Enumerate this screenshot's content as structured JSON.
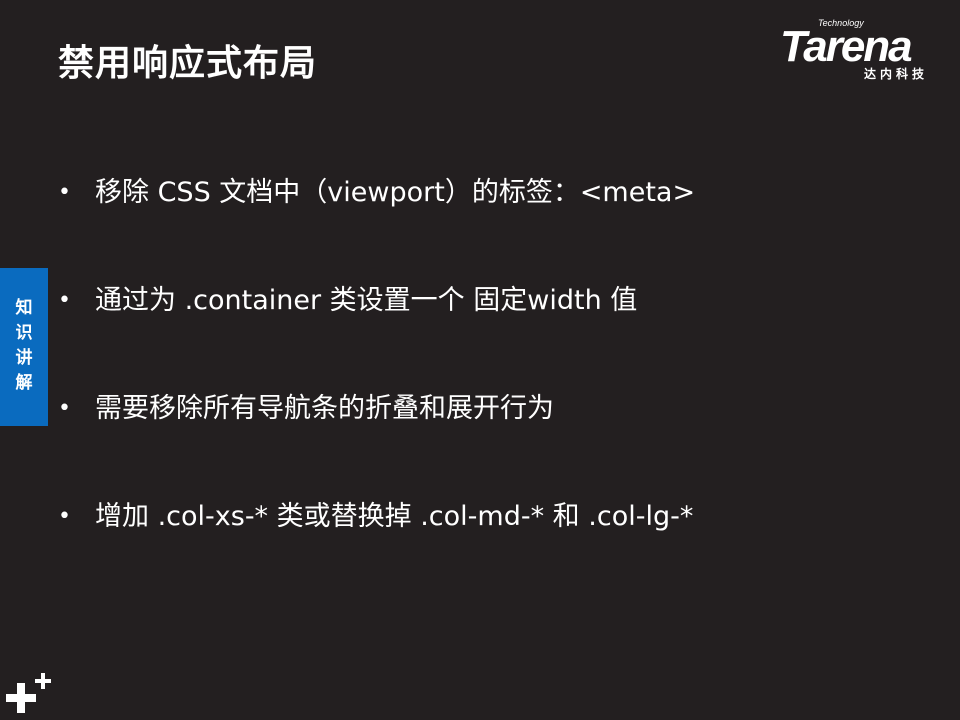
{
  "slide": {
    "title": "禁用响应式布局",
    "logo": {
      "technology": "Technology",
      "brand": "Tarena",
      "chinese": "达内科技"
    },
    "side_tab": {
      "chars": [
        "知",
        "识",
        "讲",
        "解"
      ]
    },
    "bullets": [
      {
        "marker": "•",
        "text": "移除 CSS 文档中（viewport）的标签：<meta>"
      },
      {
        "marker": "•",
        "text": "通过为 .container 类设置一个 固定width 值"
      },
      {
        "marker": "•",
        "text": "需要移除所有导航条的折叠和展开行为"
      },
      {
        "marker": "•",
        "text": "增加 .col-xs-* 类或替换掉 .col-md-* 和 .col-lg-*"
      }
    ]
  },
  "colors": {
    "background": "#231f20",
    "text": "#ffffff",
    "side_tab": "#0a6bbf"
  }
}
